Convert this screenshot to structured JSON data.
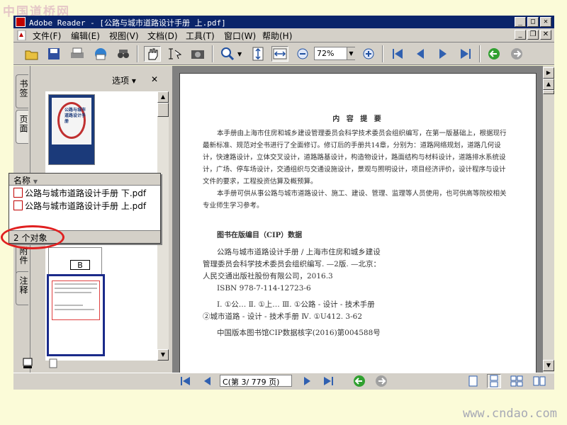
{
  "watermark": {
    "top": "中国道桥网",
    "bottom": "www.cndao.com"
  },
  "window": {
    "title": "Adobe Reader - [公路与城市道路设计手册 上.pdf]"
  },
  "menu": [
    "文件(F)",
    "编辑(E)",
    "视图(V)",
    "文档(D)",
    "工具(T)",
    "窗口(W)",
    "帮助(H)"
  ],
  "toolbar": {
    "zoom_value": "72%"
  },
  "nav_tabs": [
    "书签",
    "页面",
    "附件",
    "注释"
  ],
  "panel": {
    "options_label": "选项 ▾",
    "close_symbol": "✕"
  },
  "thumbnails": {
    "cover_title": "公路与城市道路设计手册",
    "page_label": "B"
  },
  "file_list": {
    "header": "名称",
    "files": [
      "公路与城市道路设计手册 下.pdf",
      "公路与城市道路设计手册 上.pdf"
    ],
    "status": "2 个对象"
  },
  "document": {
    "heading": "内 容 提 要",
    "paragraph1": [
      "本手册由上海市住房和城乡建设管理委员会科学技术委员会组织编写，在第一版基础上，根据现行",
      "最新标准、规范对全书进行了全面修订。修订后的手册共14章，分别为：道路网络规划，道路几何设",
      "计，快速路设计，立体交叉设计，道路路基设计，构造物设计，路面结构与材料设计，道路排水系统设",
      "计，广场、停车场设计，交通组织与交通设施设计，景观与照明设计，项目经济评价，设计程序与设计",
      "文件的要求，工程投资估算及概预算。"
    ],
    "paragraph2": [
      "本手册可供从事公路与城市道路设计、施工、建设、管理、监理等人员使用，也可供高等院校相关",
      "专业师生学习参考。"
    ],
    "cip_title": "图书在版编目（CIP）数据",
    "cip_lines": [
      "公路与城市道路设计手册 / 上海市住房和城乡建设",
      "管理委员会科学技术委员会组织编写. —2版. —北京：",
      "人民交通出版社股份有限公司，2016.3",
      "ISBN 978-7-114-12723-6"
    ],
    "cip_class": [
      "Ⅰ. ①公… Ⅱ. ①上… Ⅲ. ①公路 - 设计 - 技术手册",
      "②城市道路 - 设计 - 技术手册 Ⅳ. ①U412. 3-62"
    ],
    "cip_footer": "中国版本图书馆CIP数据核字(2016)第004588号"
  },
  "statusbar": {
    "page_field": "C(第 3/ 779 页)"
  },
  "colors": {
    "titlebar": "#0a246a",
    "annotation": "#e02020",
    "chrome": "#d4d0c8"
  }
}
